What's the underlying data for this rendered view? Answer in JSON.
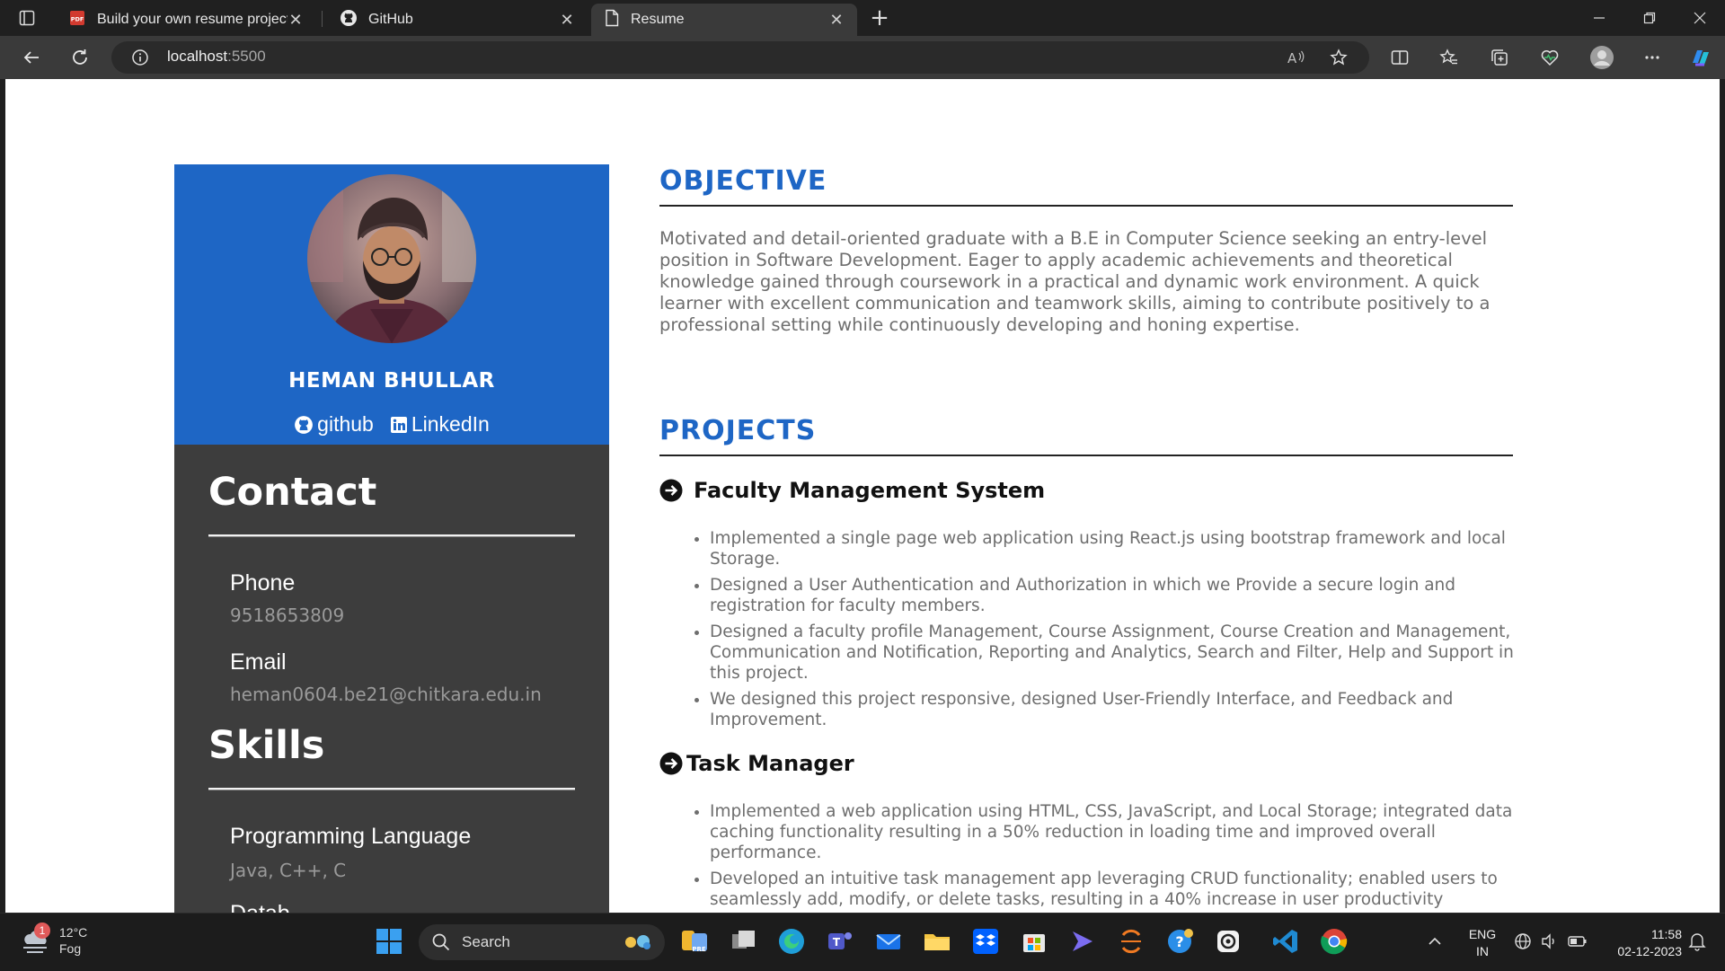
{
  "browser": {
    "tabs": [
      {
        "label": "Build your own resume project.p",
        "icon": "pdf-icon",
        "active": false
      },
      {
        "label": "GitHub",
        "icon": "github-icon",
        "active": false
      },
      {
        "label": "Resume",
        "icon": "page-icon",
        "active": true
      }
    ],
    "url_host": "localhost",
    "url_port": ":5500"
  },
  "resume": {
    "name": "HEMAN BHULLAR",
    "links": {
      "github": "github",
      "linkedin": "LinkedIn"
    },
    "contact": {
      "title": "Contact",
      "phone_label": "Phone",
      "phone": "9518653809",
      "email_label": "Email",
      "email": "heman0604.be21@chitkara.edu.in"
    },
    "skills": {
      "title": "Skills",
      "items": [
        {
          "label": "Programming Language",
          "value": "Java, C++, C"
        },
        {
          "label": "Datab"
        }
      ]
    },
    "objective": {
      "title": "OBJECTIVE",
      "text": "Motivated and detail-oriented graduate with a B.E in Computer Science seeking an entry-level position in Software Development. Eager to apply academic achievements and theoretical knowledge gained through coursework in a practical and dynamic work environment. A quick learner with excellent communication and teamwork skills, aiming to contribute positively to a professional setting while continuously developing and honing expertise."
    },
    "projects": {
      "title": "PROJECTS",
      "items": [
        {
          "title": "Faculty Management System",
          "bullets": [
            "Implemented a single page web application using React.js using bootstrap framework and local Storage.",
            "Designed a User Authentication and Authorization in which we Provide a secure login and registration for faculty members.",
            "Designed a faculty profile Management, Course Assignment, Course Creation and Management, Communication and Notification, Reporting and Analytics, Search and Filter, Help and Support in this project.",
            "We designed this project responsive, designed User-Friendly Interface, and Feedback and Improvement."
          ]
        },
        {
          "title": "Task Manager",
          "bullets": [
            "Implemented a web application using HTML, CSS, JavaScript, and Local Storage; integrated data caching functionality resulting in a 50% reduction in loading time and improved overall performance.",
            "Developed an intuitive task management app leveraging CRUD functionality; enabled users to seamlessly add, modify, or delete tasks, resulting in a 40% increase in user productivity"
          ]
        }
      ]
    }
  },
  "taskbar": {
    "weather_badge": "1",
    "weather_temp": "12°C",
    "weather_desc": "Fog",
    "search_label": "Search",
    "lang_top": "ENG",
    "lang_bottom": "IN",
    "time": "11:58",
    "date": "02-12-2023"
  }
}
